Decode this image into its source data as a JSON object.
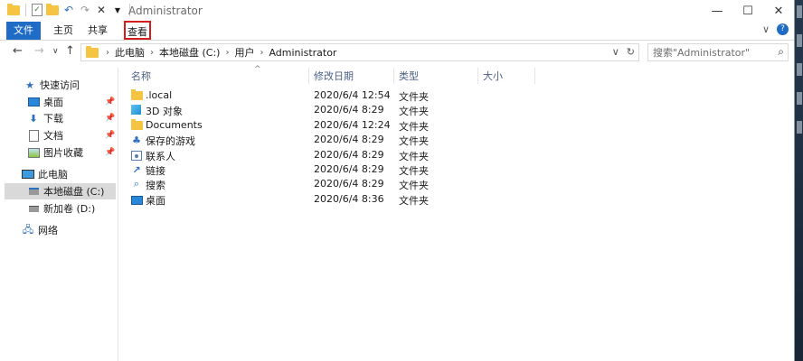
{
  "window": {
    "title": "Administrator",
    "accent": "#1e6cc5",
    "highlight_color": "#d11f1f"
  },
  "quick_access_toolbar": {
    "icons": [
      "folder-icon",
      "properties-icon",
      "new-folder-icon",
      "undo-icon",
      "redo-icon",
      "delete-icon",
      "customize-icon"
    ]
  },
  "window_controls": {
    "minimize": "—",
    "maximize": "☐",
    "close": "✕"
  },
  "ribbon": {
    "tabs": [
      "文件",
      "主页",
      "共享",
      "查看"
    ],
    "active_highlight": "查看",
    "expand": "∨",
    "help": "?"
  },
  "address_bar": {
    "back": "←",
    "forward": "→",
    "recent": "∨",
    "up": "↑",
    "crumbs": [
      "此电脑",
      "本地磁盘 (C:)",
      "用户",
      "Administrator"
    ],
    "dropdown": "∨",
    "refresh": "↻"
  },
  "search": {
    "placeholder": "搜索\"Administrator\"",
    "icon": "search-icon"
  },
  "nav_pane": {
    "quick_access": "快速访问",
    "pinned": [
      "桌面",
      "下载",
      "文档",
      "图片收藏"
    ],
    "this_pc": "此电脑",
    "drives": [
      "本地磁盘 (C:)",
      "新加卷 (D:)"
    ],
    "network": "网络",
    "selected": "本地磁盘 (C:)"
  },
  "file_list": {
    "columns": [
      "名称",
      "修改日期",
      "类型",
      "大小"
    ],
    "sort_indicator": "^",
    "rows": [
      {
        "name": ".local",
        "date": "2020/6/4 12:54",
        "type": "文件夹",
        "icon": "folder-icon"
      },
      {
        "name": "3D 对象",
        "date": "2020/6/4 8:29",
        "type": "文件夹",
        "icon": "3d-objects-icon"
      },
      {
        "name": "Documents",
        "date": "2020/6/4 12:24",
        "type": "文件夹",
        "icon": "folder-icon"
      },
      {
        "name": "保存的游戏",
        "date": "2020/6/4 8:29",
        "type": "文件夹",
        "icon": "saved-games-icon"
      },
      {
        "name": "联系人",
        "date": "2020/6/4 8:29",
        "type": "文件夹",
        "icon": "contacts-icon"
      },
      {
        "name": "链接",
        "date": "2020/6/4 8:29",
        "type": "文件夹",
        "icon": "links-icon"
      },
      {
        "name": "搜索",
        "date": "2020/6/4 8:29",
        "type": "文件夹",
        "icon": "searches-icon"
      },
      {
        "name": "桌面",
        "date": "2020/6/4 8:36",
        "type": "文件夹",
        "icon": "desktop-icon"
      }
    ]
  }
}
